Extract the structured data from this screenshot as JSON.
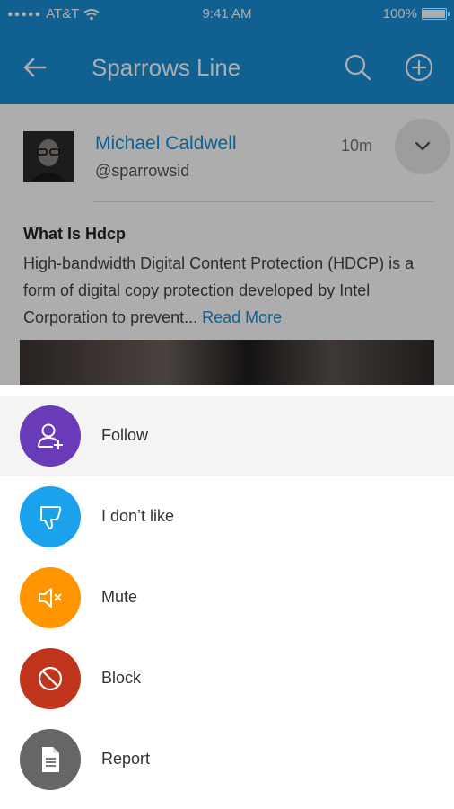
{
  "status_bar": {
    "carrier": "AT&T",
    "time": "9:41 AM",
    "battery": "100%"
  },
  "app_bar": {
    "title": "Sparrows Line"
  },
  "post": {
    "author": "Michael Caldwell",
    "handle": "@sparrowsid",
    "time": "10m",
    "title": "What Is Hdcp",
    "body": "High-bandwidth Digital Content Protection (HDCP) is a form of digital copy protection developed by Intel Corporation to prevent...",
    "read_more": "Read More"
  },
  "menu": {
    "items": [
      {
        "label": "Follow",
        "icon": "follow-user-icon",
        "color": "#6a3bb8"
      },
      {
        "label": "I don’t like",
        "icon": "thumbs-down-icon",
        "color": "#1aa3ec"
      },
      {
        "label": "Mute",
        "icon": "mute-speaker-icon",
        "color": "#ff9500"
      },
      {
        "label": "Block",
        "icon": "block-icon",
        "color": "#c0341b"
      },
      {
        "label": "Report",
        "icon": "report-document-icon",
        "color": "#666666"
      }
    ]
  },
  "colors": {
    "primary": "#1a8ed8",
    "accent_link": "#1a8ed8"
  }
}
